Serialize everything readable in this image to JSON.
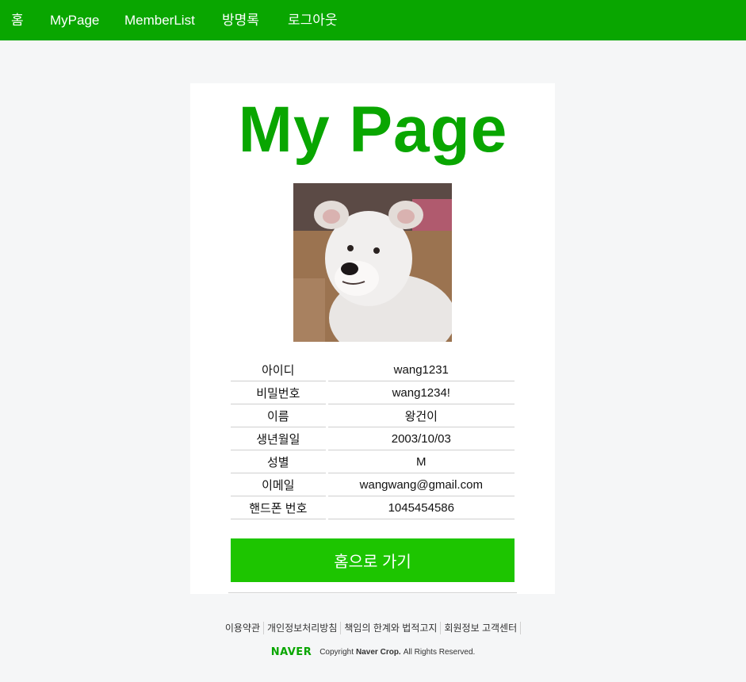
{
  "nav": {
    "home": "홈",
    "mypage": "MyPage",
    "memberlist": "MemberList",
    "guestbook": "방명록",
    "logout": "로그아웃"
  },
  "page": {
    "title": "My Page",
    "photo_alt": "profile photo of a white dog"
  },
  "profile": [
    {
      "label": "아이디",
      "value": "wang1231"
    },
    {
      "label": "비밀번호",
      "value": "wang1234!"
    },
    {
      "label": "이름",
      "value": "왕건이"
    },
    {
      "label": "생년월일",
      "value": "2003/10/03"
    },
    {
      "label": "성별",
      "value": "M"
    },
    {
      "label": "이메일",
      "value": "wangwang@gmail.com"
    },
    {
      "label": "핸드폰 번호",
      "value": "1045454586"
    }
  ],
  "actions": {
    "home_button": "홈으로 가기"
  },
  "footer": {
    "links": [
      "이용약관",
      "개인정보처리방침",
      "책임의 한계와 법적고지",
      "회원정보 고객센터"
    ],
    "logo": "NAVER",
    "copyright_prefix": "Copyright",
    "company": "Naver Crop.",
    "rights": "All Rights Reserved."
  },
  "colors": {
    "brand": "#09a600",
    "button": "#1dc500",
    "background": "#f5f6f7"
  }
}
